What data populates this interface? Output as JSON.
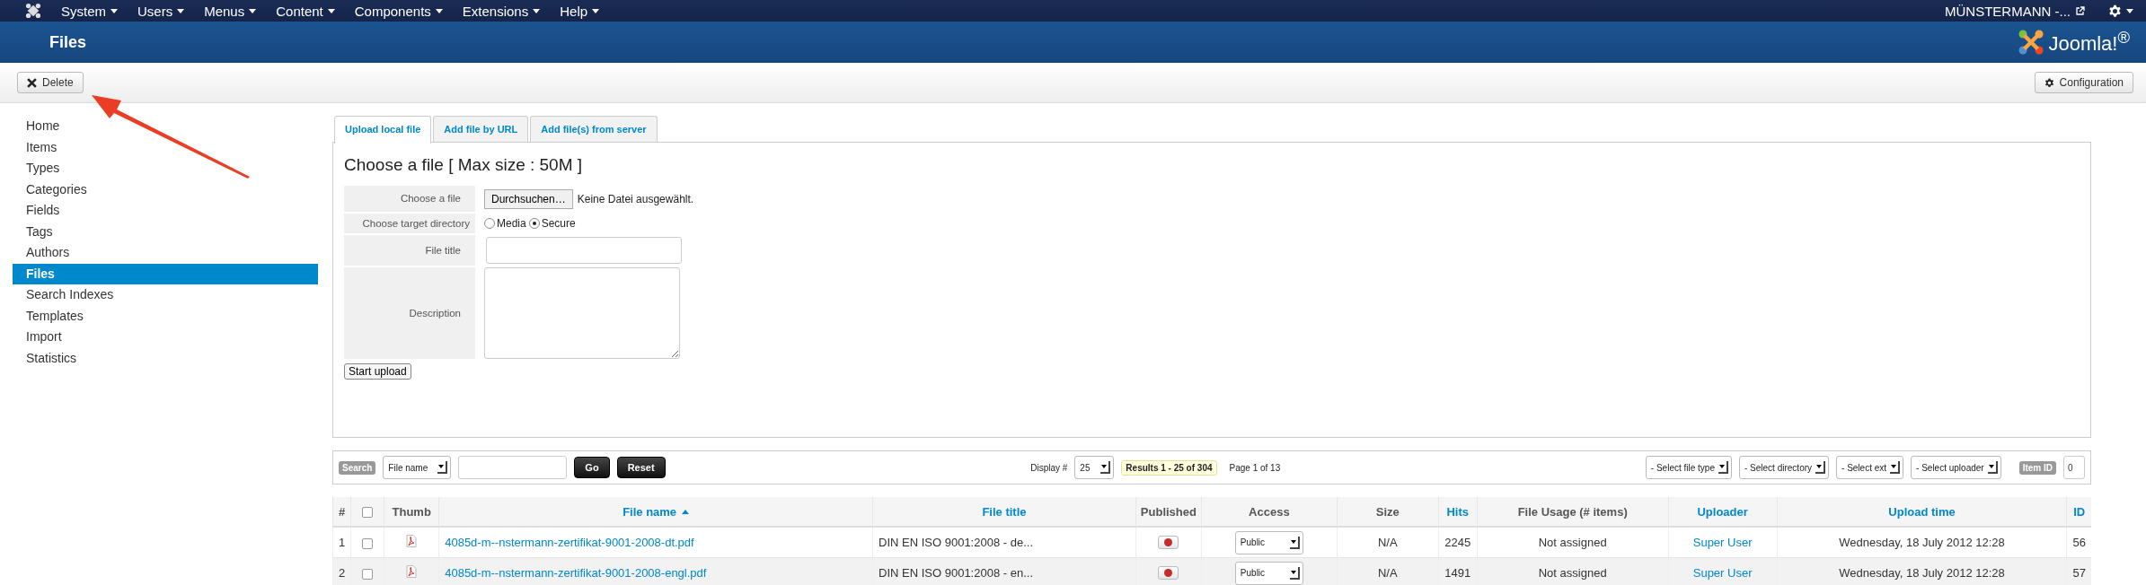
{
  "top_menu": {
    "items": [
      "System",
      "Users",
      "Menus",
      "Content",
      "Components",
      "Extensions",
      "Help"
    ],
    "user": "MÜNSTERMANN -..."
  },
  "header": {
    "title": "Files",
    "logo_text": "Joomla!$^{®}$"
  },
  "toolbar": {
    "delete": "Delete",
    "configuration": "Configuration"
  },
  "sidebar": {
    "items": [
      {
        "label": "Home",
        "selected": false
      },
      {
        "label": "Items",
        "selected": false
      },
      {
        "label": "Types",
        "selected": false
      },
      {
        "label": "Categories",
        "selected": false
      },
      {
        "label": "Fields",
        "selected": false
      },
      {
        "label": "Tags",
        "selected": false
      },
      {
        "label": "Authors",
        "selected": false
      },
      {
        "label": "Files",
        "selected": true
      },
      {
        "label": "Search Indexes",
        "selected": false
      },
      {
        "label": "Templates",
        "selected": false
      },
      {
        "label": "Import",
        "selected": false
      },
      {
        "label": "Statistics",
        "selected": false
      }
    ]
  },
  "tabs": [
    {
      "label": "Upload local file",
      "selected": true
    },
    {
      "label": "Add file by URL",
      "selected": false
    },
    {
      "label": "Add file(s) from server",
      "selected": false
    }
  ],
  "upload_form": {
    "heading": "Choose a file [ Max size : 50M ]",
    "file_label": "Choose a file",
    "browse_button": "Durchsuchen…",
    "no_file": "Keine Datei ausgewählt.",
    "directory_label": "Choose target directory",
    "directories": [
      {
        "label": "Media",
        "selected": false
      },
      {
        "label": "Secure",
        "selected": true
      }
    ],
    "title_label": "File title",
    "description_label": "Description",
    "submit": "Start upload"
  },
  "filters": {
    "search_label": "Search",
    "field_select": "File name",
    "go": "Go",
    "reset": "Reset",
    "display_label": "Display #",
    "display_value": "25",
    "results": "Results 1 - 25 of 304",
    "page": "Page 1 of 13",
    "selects": [
      "- Select file type",
      "- Select directory",
      "- Select ext",
      "- Select uploader"
    ],
    "item_id_label": "Item ID",
    "item_id_value": "0"
  },
  "table": {
    "select_all_checked": false,
    "columns": [
      {
        "label": "#",
        "sortable": false,
        "sorted": false
      },
      {
        "label": "Thumb",
        "sortable": false,
        "sorted": false
      },
      {
        "label": "File name",
        "sortable": true,
        "sorted": true
      },
      {
        "label": "File title",
        "sortable": true,
        "sorted": false
      },
      {
        "label": "Published",
        "sortable": false,
        "sorted": false
      },
      {
        "label": "Access",
        "sortable": false,
        "sorted": false
      },
      {
        "label": "Size",
        "sortable": false,
        "sorted": false
      },
      {
        "label": "Hits",
        "sortable": true,
        "sorted": false
      },
      {
        "label": "File Usage (# items)",
        "sortable": false,
        "sorted": false
      },
      {
        "label": "Uploader",
        "sortable": true,
        "sorted": false
      },
      {
        "label": "Upload time",
        "sortable": true,
        "sorted": false
      },
      {
        "label": "ID",
        "sortable": true,
        "sorted": false
      }
    ],
    "rows": [
      {
        "num": "1",
        "checked": false,
        "file_name": "4085d-m--nstermann-zertifikat-9001-2008-dt.pdf",
        "file_title": "DIN EN ISO 9001:2008 - de...",
        "published": false,
        "access": "Public",
        "size": "N/A",
        "hits": "2245",
        "usage": "Not assigned",
        "uploader": "Super User",
        "upload_time": "Wednesday, 18 July 2012 12:28",
        "id": "56"
      },
      {
        "num": "2",
        "checked": false,
        "file_name": "4085d-m--nstermann-zertifikat-9001-2008-engl.pdf",
        "file_title": "DIN EN ISO 9001:2008 - en...",
        "published": false,
        "access": "Public",
        "size": "N/A",
        "hits": "1491",
        "usage": "Not assigned",
        "uploader": "Super User",
        "upload_time": "Wednesday, 18 July 2012 12:28",
        "id": "57"
      }
    ]
  }
}
